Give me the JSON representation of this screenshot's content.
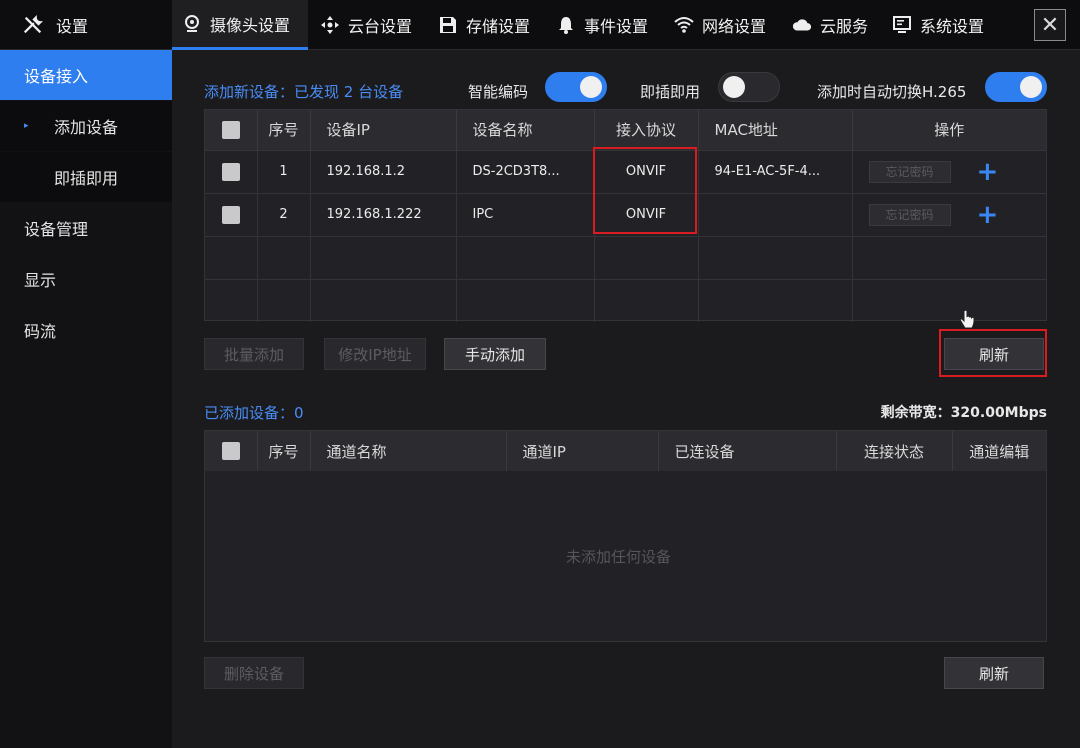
{
  "header": {
    "brand": "设置",
    "tabs": [
      {
        "label": "摄像头设置",
        "icon": "camera-icon",
        "active": true
      },
      {
        "label": "云台设置",
        "icon": "ptz-icon"
      },
      {
        "label": "存储设置",
        "icon": "save-icon"
      },
      {
        "label": "事件设置",
        "icon": "bell-icon"
      },
      {
        "label": "网络设置",
        "icon": "wifi-icon"
      },
      {
        "label": "云服务",
        "icon": "cloud-icon"
      },
      {
        "label": "系统设置",
        "icon": "monitor-icon"
      }
    ],
    "close": "✕"
  },
  "sidebar": {
    "items": [
      {
        "label": "设备接入",
        "active": true
      },
      {
        "label": "添加设备",
        "sub": true,
        "selected": true
      },
      {
        "label": "即插即用",
        "sub": true
      },
      {
        "label": "设备管理"
      },
      {
        "label": "显示"
      },
      {
        "label": "码流"
      }
    ],
    "arrow": "▸"
  },
  "discover": {
    "title": "添加新设备：已发现 2 台设备",
    "toggles": [
      {
        "label": "智能编码",
        "on": true
      },
      {
        "label": "即插即用",
        "on": false
      },
      {
        "label": "添加时自动切换H.265",
        "on": true
      }
    ],
    "columns": [
      "",
      "序号",
      "设备IP",
      "设备名称",
      "接入协议",
      "MAC地址",
      "操作"
    ],
    "rows": [
      {
        "no": "1",
        "ip": "192.168.1.2",
        "name": "DS-2CD3T8...",
        "protocol": "ONVIF",
        "mac": "94-E1-AC-5F-4...",
        "action": "忘记密码"
      },
      {
        "no": "2",
        "ip": "192.168.1.222",
        "name": "IPC",
        "protocol": "ONVIF",
        "mac": "",
        "action": "忘记密码"
      }
    ],
    "buttons": {
      "batch": "批量添加",
      "modify_ip": "修改IP地址",
      "manual": "手动添加",
      "refresh": "刷新"
    }
  },
  "added": {
    "title": "已添加设备：0",
    "bandwidth": "剩余带宽：320.00Mbps",
    "columns": [
      "",
      "序号",
      "通道名称",
      "通道IP",
      "已连设备",
      "连接状态",
      "通道编辑"
    ],
    "empty": "未添加任何设备",
    "buttons": {
      "delete": "删除设备",
      "refresh": "刷新"
    }
  },
  "colors": {
    "accent": "#2f7ef0",
    "highlight": "#d91c22"
  }
}
